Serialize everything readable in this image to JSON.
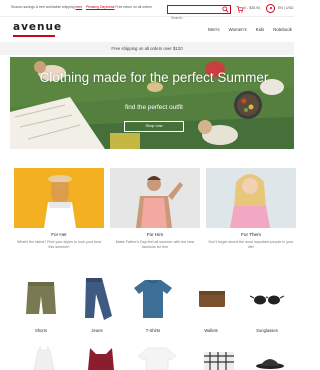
{
  "topbar": {
    "notice_text": "Season savings & free worldwide shipping",
    "notice_link": "here",
    "notice2_link": "Pleasing Daybreak",
    "notice2_text": "Free return on all orders",
    "search_placeholder": "Search...",
    "cart_info": "0 - $35.94",
    "lang": "EN | USD"
  },
  "header": {
    "logo": "avenue",
    "nav": [
      "Men's",
      "Women's",
      "Kids",
      "Notebook"
    ]
  },
  "shipping_bar": "Free shipping on all orders over $120",
  "hero": {
    "title": "Clothing made for the perfect Summer",
    "subtitle": "find the perfect outfit",
    "button": "Shop now"
  },
  "categories": [
    {
      "title": "For Her",
      "desc": "What's the latest? Find your styles to look your best this summer!"
    },
    {
      "title": "For Him",
      "desc": "Make Father's Day feel all summer with the best fashions for him"
    },
    {
      "title": "For Them",
      "desc": "Don't forget about the most important people in your life!"
    }
  ],
  "products": [
    "Shorts",
    "Jeans",
    "T-Shirts",
    "Wallets",
    "Sunglasses"
  ],
  "colors": {
    "accent": "#d0021b",
    "heroGrass": "#4d7a3e"
  }
}
